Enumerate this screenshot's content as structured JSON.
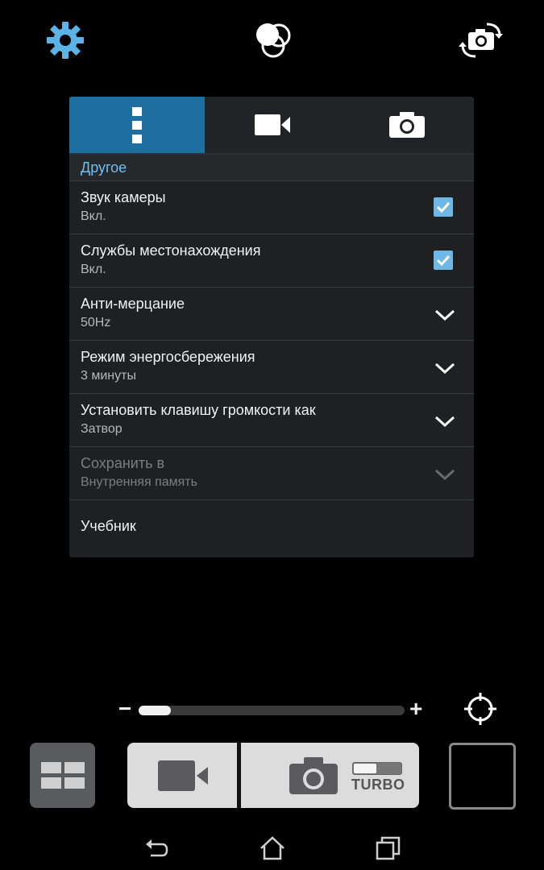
{
  "top_bar": {
    "settings_icon": "gear-icon",
    "filters_icon": "color-effects-icon",
    "switch_camera_icon": "switch-camera-icon"
  },
  "tabs": [
    {
      "icon": "more-vertical-icon",
      "active": true
    },
    {
      "icon": "video-camera-icon",
      "active": false
    },
    {
      "icon": "photo-camera-icon",
      "active": false
    }
  ],
  "settings": {
    "section_title": "Другое",
    "items": [
      {
        "title": "Звук камеры",
        "value": "Вкл.",
        "control": "checkbox",
        "checked": true,
        "enabled": true
      },
      {
        "title": "Службы местонахождения",
        "value": "Вкл.",
        "control": "checkbox",
        "checked": true,
        "enabled": true
      },
      {
        "title": "Анти-мерцание",
        "value": "50Hz",
        "control": "dropdown",
        "enabled": true
      },
      {
        "title": "Режим энергосбережения",
        "value": "3 минуты",
        "control": "dropdown",
        "enabled": true
      },
      {
        "title": "Установить клавишу громкости как",
        "value": "Затвор",
        "control": "dropdown",
        "enabled": true
      },
      {
        "title": "Сохранить в",
        "value": "Внутренняя память",
        "control": "dropdown",
        "enabled": false
      },
      {
        "title": "Учебник",
        "control": "none",
        "enabled": true
      }
    ]
  },
  "zoom": {
    "minus": "−",
    "plus": "+",
    "level": 0.12
  },
  "bottom_bar": {
    "turbo_label": "TURBO",
    "turbo_on": false
  },
  "colors": {
    "accent": "#1e6fa0",
    "checkbox": "#6fb8e6",
    "header_text": "#6ec0f0",
    "gear": "#5cb3e8"
  }
}
